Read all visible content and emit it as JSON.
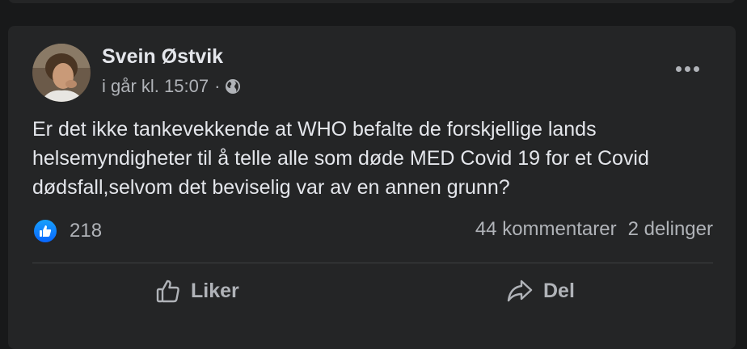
{
  "post": {
    "author": "Svein Østvik",
    "timestamp": "i går kl. 15:07",
    "separator": "·",
    "privacy_icon": "globe-icon",
    "text": "Er det ikke tankevekkende at WHO befalte de forskjellige lands helsemyndigheter til å telle alle som døde MED Covid 19 for et Covid dødsfall,selvom det beviselig var av en annen grunn?",
    "reaction_icon": "thumbs-up-icon",
    "reaction_count": "218",
    "comments": "44 kommentarer",
    "shares": "2 delinger"
  },
  "actions": {
    "like_label": "Liker",
    "share_label": "Del"
  },
  "colors": {
    "background": "#18191a",
    "card": "#242526",
    "text_primary": "#e4e6eb",
    "text_secondary": "#b0b3b8",
    "like_blue": "#0866ff"
  }
}
